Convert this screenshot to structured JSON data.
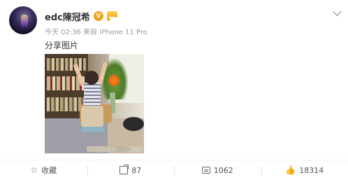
{
  "post": {
    "username": "edc陳冠希",
    "verified_badge": "V",
    "timestamp": "今天 02:36",
    "source": "来自 iPhone 11 Pro",
    "text": "分享图片"
  },
  "actions": {
    "favorite_label": "收藏",
    "repost_count": "87",
    "comment_count": "1062",
    "like_count": "18314"
  },
  "icons": [
    "avatar",
    "verified-icon",
    "vip-icon",
    "chevron-down-icon",
    "star-icon",
    "share-icon",
    "comment-icon",
    "thumbs-up-icon"
  ],
  "colors": {
    "username": "#333333",
    "meta": "#999999",
    "verified_badge": "#f0a21b"
  }
}
